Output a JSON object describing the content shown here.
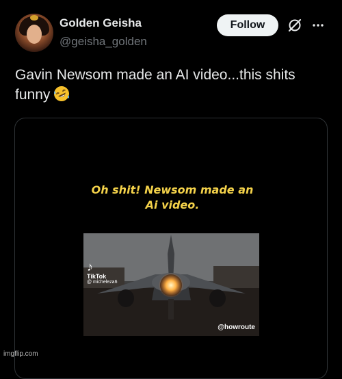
{
  "post": {
    "author_name": "Golden Geisha",
    "author_handle": "@geisha_golden",
    "follow_label": "Follow",
    "text": "Gavin Newsom made an AI video...this shits funny",
    "emoji": "rolling-on-floor-laughing"
  },
  "media": {
    "caption": "Oh shit! Newsom made an Ai video.",
    "tiktok_brand": "TikTok",
    "tiktok_user": "@ micheleza6",
    "watermark": "@howroute"
  },
  "watermark": "imgflip.com",
  "icons": [
    "grok-icon",
    "more-icon",
    "tiktok-icon"
  ],
  "colors": {
    "background": "#000000",
    "text": "#e7e9ea",
    "secondary_text": "#71767b",
    "follow_button_bg": "#eff3f4",
    "caption": "#f4d24a"
  }
}
